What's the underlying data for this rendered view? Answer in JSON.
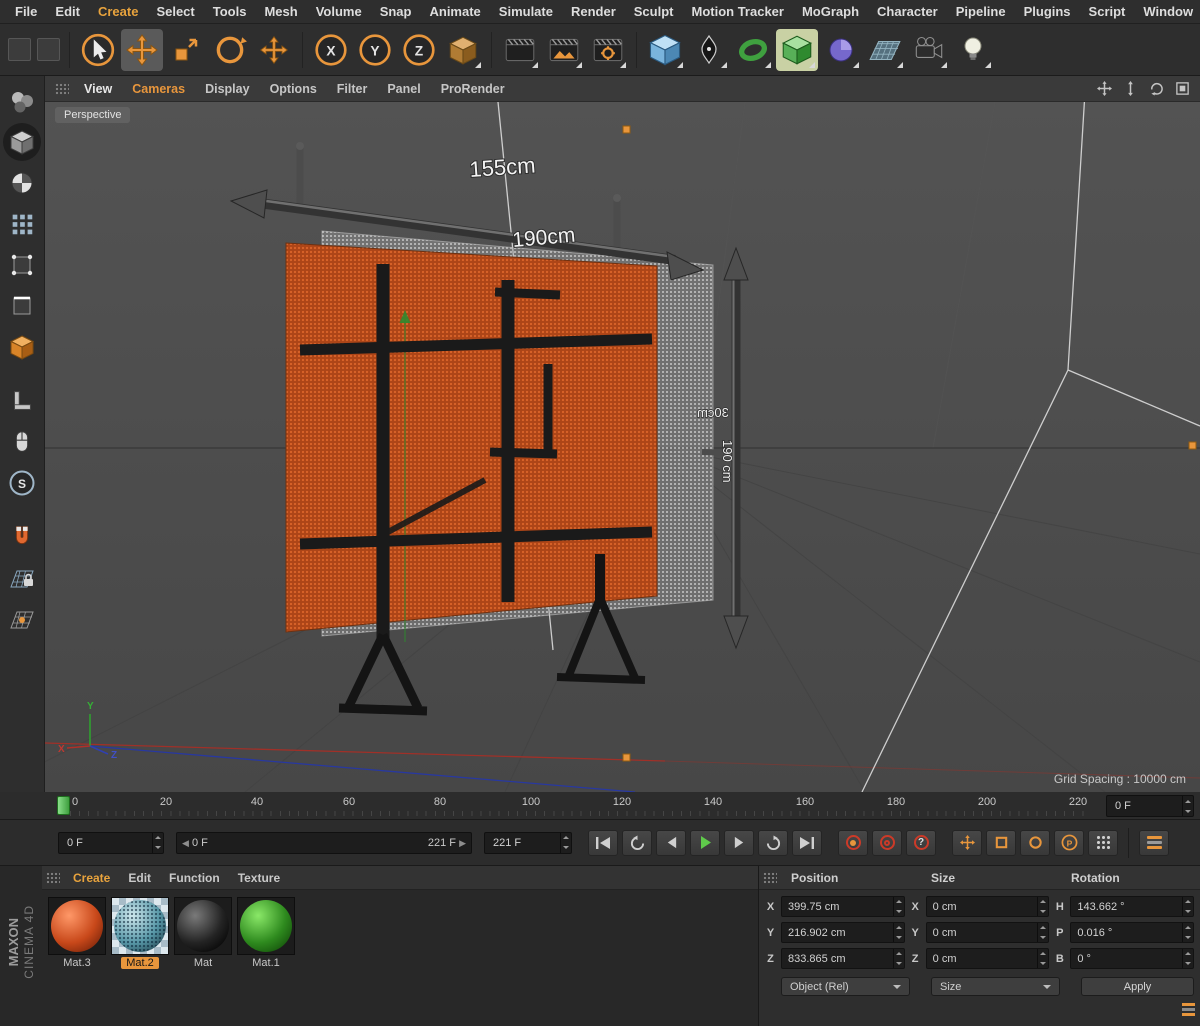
{
  "menubar": {
    "items": [
      "File",
      "Edit",
      "Create",
      "Select",
      "Tools",
      "Mesh",
      "Volume",
      "Snap",
      "Animate",
      "Simulate",
      "Render",
      "Sculpt",
      "Motion Tracker",
      "MoGraph",
      "Character",
      "Pipeline",
      "Plugins",
      "Script",
      "Window"
    ]
  },
  "toolbar": {
    "axis_labels": {
      "x": "X",
      "y": "Y",
      "z": "Z"
    }
  },
  "sidebar": {
    "snap_label": "S"
  },
  "viewport": {
    "menu_items": [
      "View",
      "Cameras",
      "Display",
      "Options",
      "Filter",
      "Panel",
      "ProRender"
    ],
    "camera_label": "Perspective",
    "grid_spacing": "Grid Spacing : 10000 cm",
    "dimensions": {
      "top": "155cm",
      "front": "190cm",
      "side_vertical": "190 cm",
      "side_mirrored": "30cm"
    },
    "axis_gizmo": {
      "x": "X",
      "y": "Y",
      "z": "Z"
    }
  },
  "timeline": {
    "ticks": [
      "0",
      "20",
      "40",
      "60",
      "80",
      "100",
      "120",
      "140",
      "160",
      "180",
      "200",
      "220"
    ],
    "frame_field": "0 F"
  },
  "transport": {
    "current_frame": "0 F",
    "range_start": "0 F",
    "range_end": "221 F",
    "end_frame": "221 F"
  },
  "icons": {
    "question_mark": "?",
    "p_label": "P"
  },
  "materials": {
    "menu_items": [
      "Create",
      "Edit",
      "Function",
      "Texture"
    ],
    "items": [
      {
        "name": "Mat.3",
        "selected": false
      },
      {
        "name": "Mat.2",
        "selected": true
      },
      {
        "name": "Mat",
        "selected": false
      },
      {
        "name": "Mat.1",
        "selected": false
      }
    ],
    "brand_top": "MAXON",
    "brand_bottom": "CINEMA 4D"
  },
  "coordinates": {
    "headers": [
      "Position",
      "Size",
      "Rotation"
    ],
    "rows": [
      {
        "pos_label": "X",
        "pos_value": "399.75 cm",
        "size_label": "X",
        "size_value": "0 cm",
        "rot_label": "H",
        "rot_value": "143.662 °"
      },
      {
        "pos_label": "Y",
        "pos_value": "216.902 cm",
        "size_label": "Y",
        "size_value": "0 cm",
        "rot_label": "P",
        "rot_value": "0.016 °"
      },
      {
        "pos_label": "Z",
        "pos_value": "833.865 cm",
        "size_label": "Z",
        "size_value": "0 cm",
        "rot_label": "B",
        "rot_value": "0 °"
      }
    ],
    "mode_dropdown": "Object (Rel)",
    "size_dropdown": "Size",
    "apply_button": "Apply"
  },
  "colors": {
    "accent": "#e8963c",
    "led_orange": "#ad4517",
    "viewport_bg": "#4c4c4c"
  }
}
